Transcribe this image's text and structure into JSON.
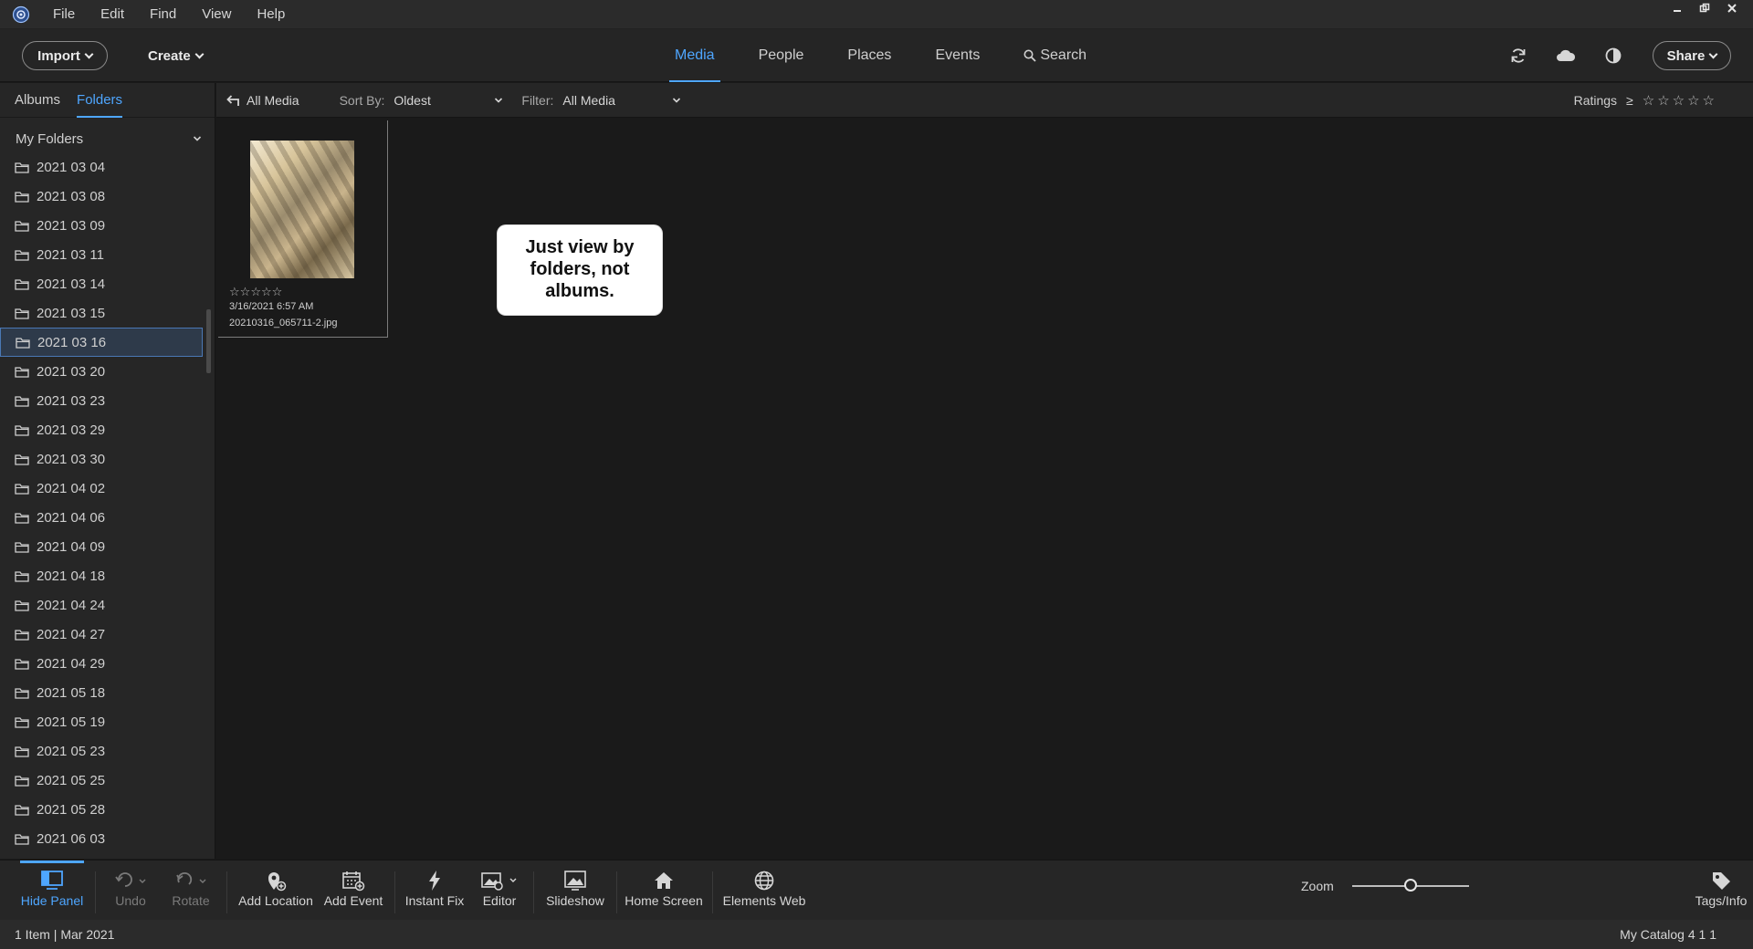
{
  "menubar": {
    "items": [
      "File",
      "Edit",
      "Find",
      "View",
      "Help"
    ]
  },
  "toolbar": {
    "import_label": "Import",
    "create_label": "Create",
    "tabs": [
      "Media",
      "People",
      "Places",
      "Events"
    ],
    "search_label": "Search",
    "share_label": "Share",
    "active_tab": "Media"
  },
  "sidebar": {
    "tabs": [
      "Albums",
      "Folders"
    ],
    "active_tab": "Folders",
    "section_title": "My Folders",
    "folders": [
      "2021 03 04",
      "2021 03 08",
      "2021 03 09",
      "2021 03 11",
      "2021 03 14",
      "2021 03 15",
      "2021 03 16",
      "2021 03 20",
      "2021 03 23",
      "2021 03 29",
      "2021 03 30",
      "2021 04 02",
      "2021 04 06",
      "2021 04 09",
      "2021 04 18",
      "2021 04 24",
      "2021 04 27",
      "2021 04 29",
      "2021 05 18",
      "2021 05 19",
      "2021 05 23",
      "2021 05 25",
      "2021 05 28",
      "2021 06 03"
    ],
    "selected_folder": "2021 03 16"
  },
  "filterbar": {
    "back_label": "All Media",
    "sort_label": "Sort By:",
    "sort_value": "Oldest",
    "filter_label": "Filter:",
    "filter_value": "All Media",
    "ratings_label": "Ratings",
    "ratings_op": "≥",
    "ratings_value": 0
  },
  "media": {
    "items": [
      {
        "date": "3/16/2021 6:57 AM",
        "filename": "20210316_065711-2.jpg",
        "rating": 0
      }
    ],
    "callout": "Just view by folders, not albums."
  },
  "bottombar": {
    "hide_panel": "Hide Panel",
    "undo": "Undo",
    "rotate": "Rotate",
    "add_location": "Add Location",
    "add_event": "Add Event",
    "instant_fix": "Instant Fix",
    "editor": "Editor",
    "slideshow": "Slideshow",
    "home_screen": "Home Screen",
    "elements_web": "Elements Web",
    "zoom_label": "Zoom",
    "zoom_level": 0.5,
    "tags_info": "Tags/Info"
  },
  "statusbar": {
    "left": "1 Item | Mar 2021",
    "right": "My Catalog 4 1 1"
  },
  "colors": {
    "accent": "#4ea6ff",
    "background": "#1a1a1a",
    "panel": "#262626"
  }
}
